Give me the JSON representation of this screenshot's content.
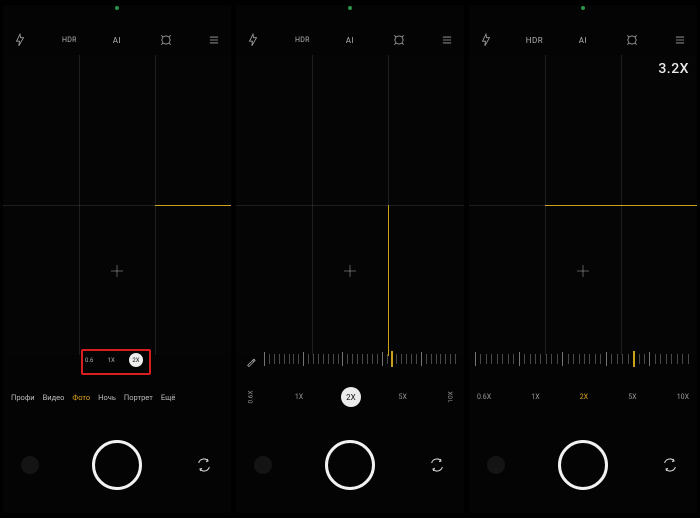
{
  "top_icons": {
    "flash": "flash-icon",
    "hdr": "HDR",
    "ai": "AI",
    "filters": "filters-icon",
    "menu": "menu-icon"
  },
  "pane1": {
    "modes": [
      "Профи",
      "Видео",
      "Фото",
      "Ночь",
      "Портрет",
      "Ещё"
    ],
    "selected_mode_index": 2,
    "zoom_pills": [
      "0.6",
      "1X",
      "2X"
    ]
  },
  "pane2": {
    "zoom_levels": [
      "0.6X",
      "1X",
      "2X",
      "5X",
      "10X"
    ],
    "selected_zoom": "2X"
  },
  "pane3": {
    "zoom_readout": "3.2X",
    "zoom_levels": [
      "0.6X",
      "1X",
      "2X",
      "5X",
      "10X"
    ],
    "selected_zoom": "2X"
  }
}
